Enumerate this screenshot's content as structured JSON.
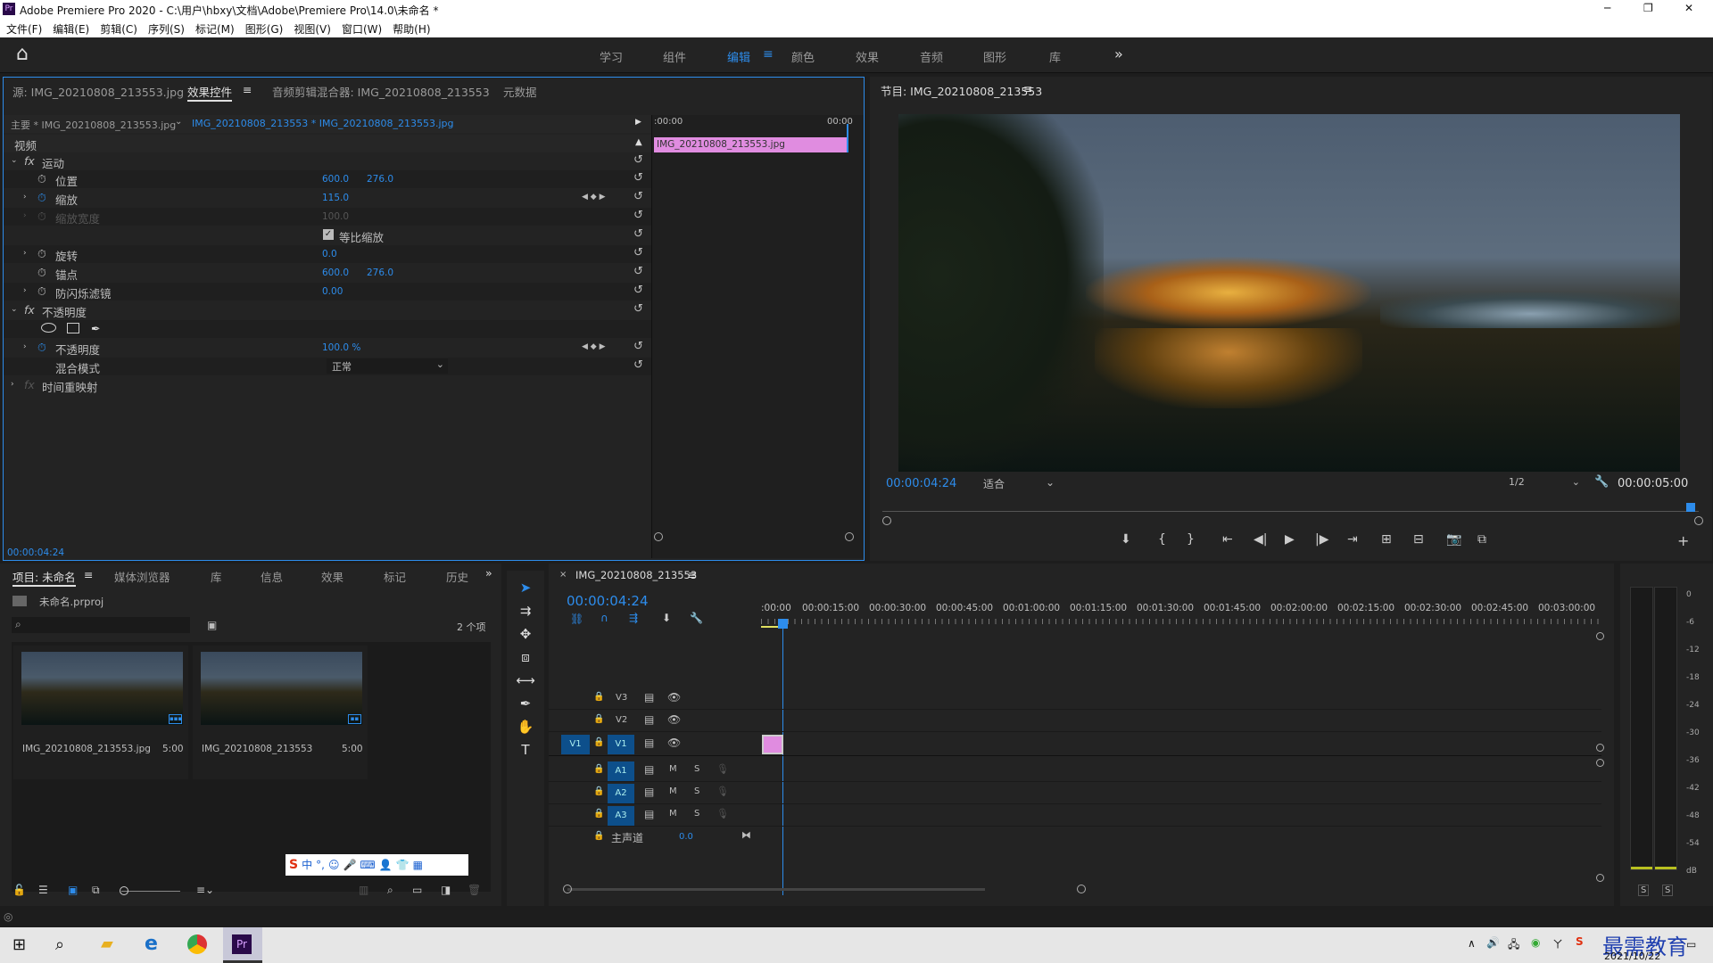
{
  "window": {
    "title": "Adobe Premiere Pro 2020 - C:\\用户\\hbxy\\文档\\Adobe\\Premiere Pro\\14.0\\未命名 *",
    "minimize": "─",
    "maximize": "❐",
    "close": "✕",
    "app_badge": "Pr"
  },
  "menu": [
    "文件(F)",
    "编辑(E)",
    "剪辑(C)",
    "序列(S)",
    "标记(M)",
    "图形(G)",
    "视图(V)",
    "窗口(W)",
    "帮助(H)"
  ],
  "workspaces": {
    "home": "⌂",
    "tabs": [
      "学习",
      "组件",
      "编辑",
      "颜色",
      "效果",
      "音频",
      "图形",
      "库"
    ],
    "active": "编辑",
    "more": "»"
  },
  "source_panel": {
    "tabs": [
      "源: IMG_20210808_213553.jpg",
      "效果控件",
      "音频剪辑混合器: IMG_20210808_213553",
      "元数据"
    ],
    "menu_icon": "≡",
    "master": "主要 * IMG_20210808_213553.jpg",
    "sequence_clip": "IMG_20210808_213553 * IMG_20210808_213553.jpg",
    "mini_tl_start": ":00:00",
    "mini_tl_end": "00:00",
    "clip_label": "IMG_20210808_213553.jpg",
    "video_header": "视频",
    "motion": "运动",
    "position": "位置",
    "position_x": "600.0",
    "position_y": "276.0",
    "scale": "缩放",
    "scale_val": "115.0",
    "scale_width": "缩放宽度",
    "scale_width_val": "100.0",
    "uniform_scale": "等比缩放",
    "rotation": "旋转",
    "rotation_val": "0.0",
    "anchor": "锚点",
    "anchor_x": "600.0",
    "anchor_y": "276.0",
    "antiflicker": "防闪烁滤镜",
    "antiflicker_val": "0.00",
    "opacity_group": "不透明度",
    "opacity": "不透明度",
    "opacity_val": "100.0 %",
    "blend_mode": "混合模式",
    "blend_val": "正常",
    "time_remap": "时间重映射",
    "fx": "fx",
    "timecode": "00:00:04:24"
  },
  "program": {
    "title": "节目: IMG_20210808_213553",
    "timecode": "00:00:04:24",
    "fit": "适合",
    "resolution": "1/2",
    "duration": "00:00:05:00"
  },
  "project": {
    "tabs": [
      "项目: 未命名",
      "媒体浏览器",
      "库",
      "信息",
      "效果",
      "标记",
      "历史"
    ],
    "file": "未命名.prproj",
    "items_count": "2 个项",
    "items": [
      {
        "name": "IMG_20210808_213553.jpg",
        "dur": "5:00"
      },
      {
        "name": "IMG_20210808_213553",
        "dur": "5:00"
      }
    ]
  },
  "timeline": {
    "title": "IMG_20210808_213553",
    "timecode": "00:00:04:24",
    "ruler": [
      ":00:00",
      "00:00:15:00",
      "00:00:30:00",
      "00:00:45:00",
      "00:01:00:00",
      "00:01:15:00",
      "00:01:30:00",
      "00:01:45:00",
      "00:02:00:00",
      "00:02:15:00",
      "00:02:30:00",
      "00:02:45:00",
      "00:03:00:00"
    ],
    "tracks": [
      "V3",
      "V2",
      "V1",
      "A1",
      "A2",
      "A3"
    ],
    "source_v1": "V1",
    "mute": "M",
    "solo": "S",
    "master": "主声道",
    "master_val": "0.0"
  },
  "meters": {
    "labels": [
      "0",
      "-6",
      "-12",
      "-18",
      "-24",
      "-30",
      "-36",
      "-42",
      "-48",
      "-54",
      "dB"
    ],
    "solo": "S"
  },
  "ime": {
    "logo": "S",
    "chars": [
      "中",
      "°,",
      "☺",
      "🎤",
      "⌨",
      "👤",
      "👕",
      "▦"
    ]
  },
  "taskbar": {
    "date": "2021/10/22",
    "watermark": "最需教育"
  },
  "colors": {
    "accent": "#2d8ceb",
    "clip": "#e08ce0",
    "track_btn": "#0d4f8b"
  }
}
